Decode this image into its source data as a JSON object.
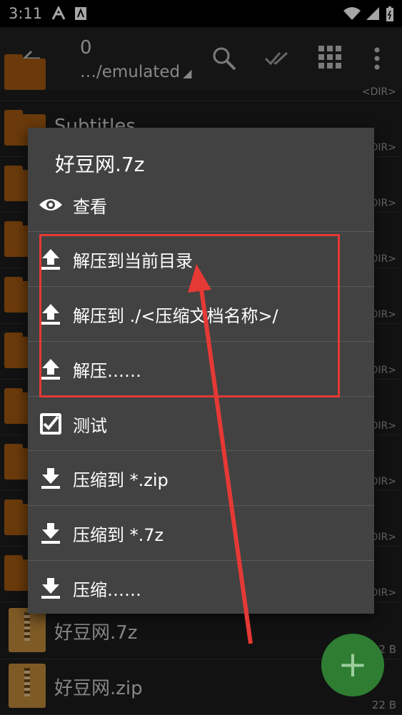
{
  "status": {
    "time": "3:11"
  },
  "toolbar": {
    "count": "0",
    "path": "…/emulated",
    "path_arrow": "◢"
  },
  "list": {
    "dir_label": "<DIR>",
    "partial_folder_name": "Subtitles",
    "files": [
      {
        "name": "好豆网.7z",
        "size": "22 B"
      },
      {
        "name": "好豆网.zip",
        "size": "22 B"
      }
    ]
  },
  "dialog": {
    "title": "好豆网.7z",
    "items": [
      {
        "label": "查看",
        "icon": "eye-icon"
      },
      {
        "label": "解压到当前目录",
        "icon": "upload-icon"
      },
      {
        "label": "解压到 ./<压缩文档名称>/",
        "icon": "upload-icon"
      },
      {
        "label": "解压……",
        "icon": "upload-icon"
      },
      {
        "label": "测试",
        "icon": "checkbox-icon"
      },
      {
        "label": "压缩到 *.zip",
        "icon": "download-icon"
      },
      {
        "label": "压缩到 *.7z",
        "icon": "download-icon"
      },
      {
        "label": "压缩……",
        "icon": "download-icon"
      }
    ]
  },
  "fab": {
    "label": "+"
  },
  "colors": {
    "highlight": "#e53935",
    "folder": "#a35a12",
    "fab": "#2e7d32"
  }
}
